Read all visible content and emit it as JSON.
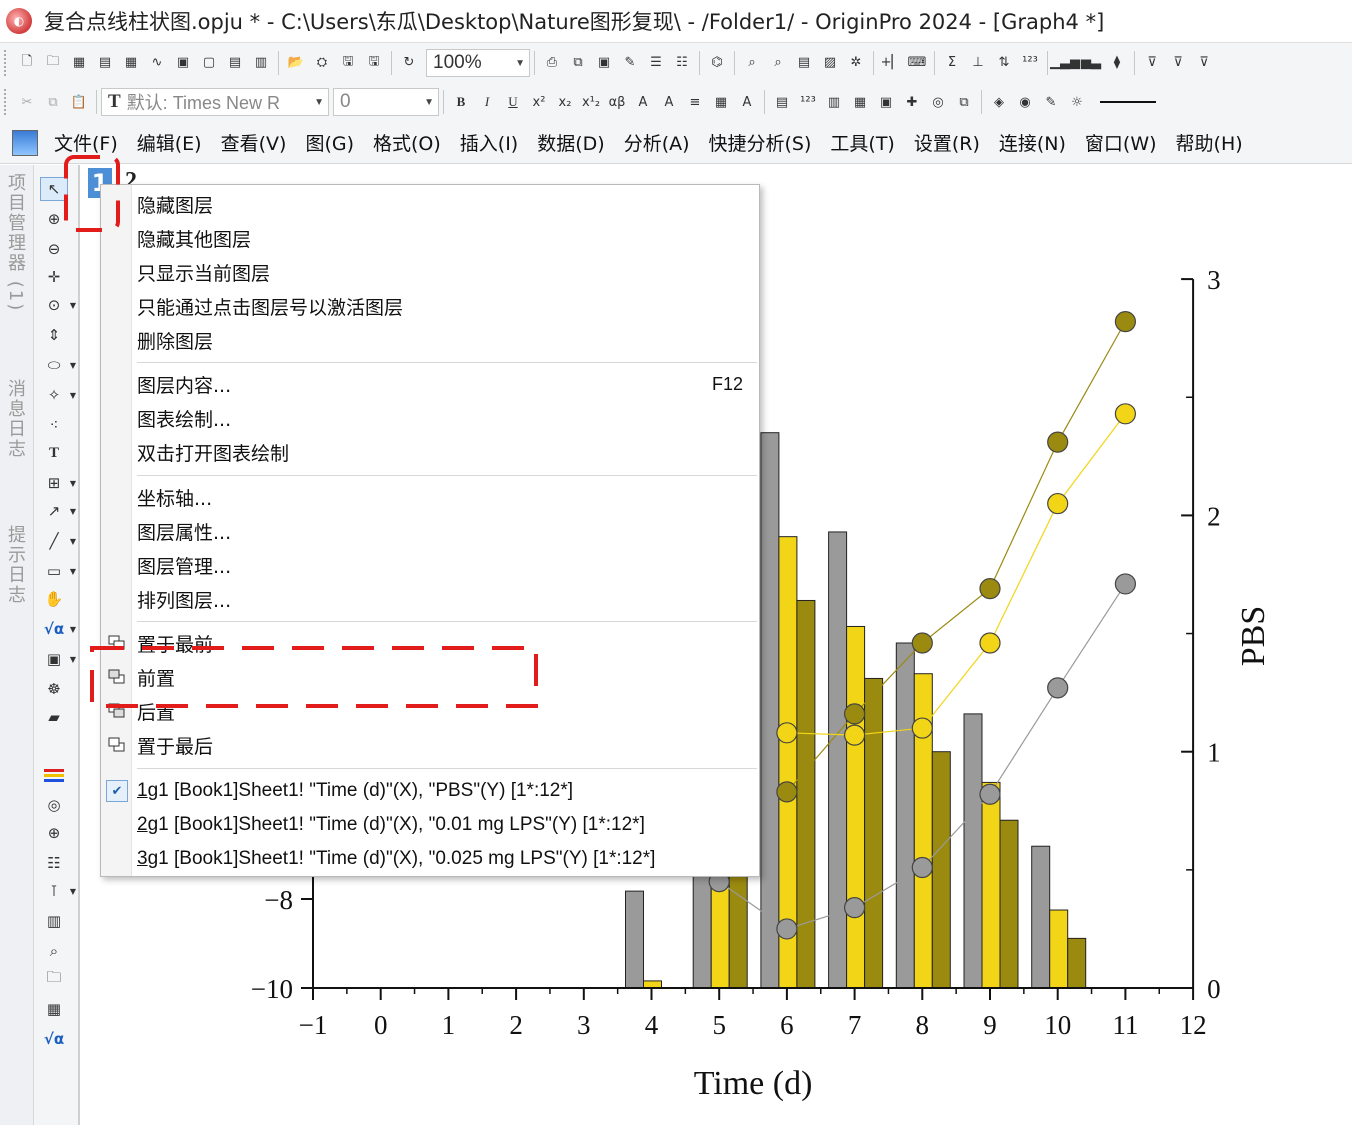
{
  "window": {
    "title": "复合点线柱状图.opju * - C:\\Users\\东瓜\\Desktop\\Nature图形复现\\ - /Folder1/ - OriginPro 2024 - [Graph4 *]"
  },
  "toolbar1": {
    "zoom_value": "100%"
  },
  "toolbar2": {
    "font_value": "默认: Times New R",
    "font_size_value": "0"
  },
  "menubar": {
    "items": [
      "文件(F)",
      "编辑(E)",
      "查看(V)",
      "图(G)",
      "格式(O)",
      "插入(I)",
      "数据(D)",
      "分析(A)",
      "快捷分析(S)",
      "工具(T)",
      "设置(R)",
      "连接(N)",
      "窗口(W)",
      "帮助(H)"
    ]
  },
  "left_dock": {
    "tabs": [
      "项目管理器 (1)",
      "消息日志",
      "提示日志"
    ]
  },
  "graph": {
    "layer_tabs": [
      "1",
      "2"
    ]
  },
  "context_menu": {
    "items": [
      {
        "label": "隐藏图层"
      },
      {
        "label": "隐藏其他图层"
      },
      {
        "label": "只显示当前图层"
      },
      {
        "label": "只能通过点击图层号以激活图层"
      },
      {
        "label": "删除图层"
      },
      {
        "label": "图层内容...",
        "shortcut": "F12"
      },
      {
        "label": "图表绘制..."
      },
      {
        "label": "双击打开图表绘制"
      },
      {
        "label": "坐标轴..."
      },
      {
        "label": "图层属性..."
      },
      {
        "label": "图层管理..."
      },
      {
        "label": "排列图层..."
      },
      {
        "label": "置于最前"
      },
      {
        "label": "前置"
      },
      {
        "label": "后置"
      },
      {
        "label": "置于最后"
      }
    ],
    "plots": [
      {
        "num": "1",
        "text": " g1 [Book1]Sheet1! \"Time (d)\"(X), \"PBS\"(Y) [1*:12*]",
        "checked": true
      },
      {
        "num": "2",
        "text": " g1 [Book1]Sheet1! \"Time (d)\"(X), \"0.01 mg LPS\"(Y) [1*:12*]",
        "checked": false
      },
      {
        "num": "3",
        "text": " g1 [Book1]Sheet1! \"Time (d)\"(X), \"0.025 mg LPS\"(Y) [1*:12*]",
        "checked": false
      }
    ]
  },
  "colors": {
    "gray": "#9a9a9a",
    "yellow": "#f2d516",
    "olive": "#9b8a10",
    "highlight": "#e21b1b"
  },
  "chart_data": {
    "type": "bar",
    "xlabel": "Time (d)",
    "y2label": "PBS",
    "xlim": [
      -1,
      12
    ],
    "x_ticks": [
      -1,
      0,
      1,
      2,
      3,
      4,
      5,
      6,
      7,
      8,
      9,
      10,
      11,
      12
    ],
    "y_left_visible_ticks": [
      -8,
      -10
    ],
    "y_right_ticks": [
      0,
      1,
      2,
      3
    ],
    "y_right_lim": [
      0,
      3
    ],
    "bars": {
      "categories": [
        4,
        5,
        6,
        7,
        8,
        9,
        10
      ],
      "series": [
        {
          "color": "gray",
          "values": [
            0.41,
            1.15,
            2.35,
            1.93,
            1.46,
            1.16,
            0.6
          ]
        },
        {
          "color": "yellow",
          "values": [
            0.03,
            0.55,
            1.91,
            1.53,
            1.33,
            0.87,
            0.33
          ]
        },
        {
          "color": "olive",
          "values": [
            0.0,
            0.55,
            1.64,
            1.31,
            1.0,
            0.71,
            0.21
          ]
        }
      ]
    },
    "lines": [
      {
        "color": "olive",
        "x": [
          6,
          7,
          8,
          9,
          10,
          11
        ],
        "y": [
          0.83,
          1.16,
          1.46,
          1.69,
          2.31,
          2.82
        ]
      },
      {
        "color": "yellow",
        "x": [
          6,
          7,
          8,
          9,
          10,
          11
        ],
        "y": [
          1.08,
          1.07,
          1.1,
          1.46,
          2.05,
          2.43
        ]
      },
      {
        "color": "gray",
        "x": [
          5,
          6,
          7,
          8,
          9,
          10,
          11
        ],
        "y": [
          0.45,
          0.25,
          0.34,
          0.51,
          0.82,
          1.27,
          1.71
        ]
      }
    ]
  }
}
